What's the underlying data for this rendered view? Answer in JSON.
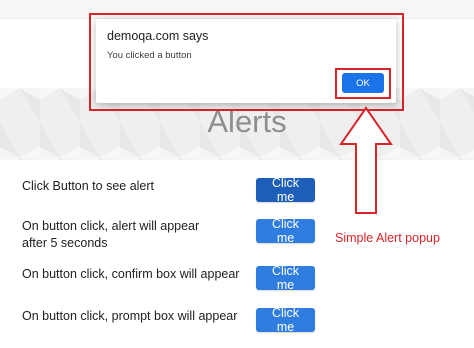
{
  "page": {
    "title": "Alerts"
  },
  "rows": [
    {
      "label": "Click Button to see alert",
      "button": "Click me"
    },
    {
      "label": "On button click, alert will appear after 5 seconds",
      "button": "Click me"
    },
    {
      "label": "On button click, confirm box will appear",
      "button": "Click me"
    },
    {
      "label": "On button click, prompt box will appear",
      "button": "Click me"
    }
  ],
  "alert": {
    "origin": "demoqa.com says",
    "message": "You clicked a button",
    "ok_label": "OK"
  },
  "annotation": {
    "text": "Simple Alert popup",
    "color": "#d9252a",
    "arrow": "up-arrow-outline"
  },
  "colors": {
    "button": "#2f7ddf",
    "dialog_ok": "#1a73e8",
    "highlight": "#d9252a"
  }
}
